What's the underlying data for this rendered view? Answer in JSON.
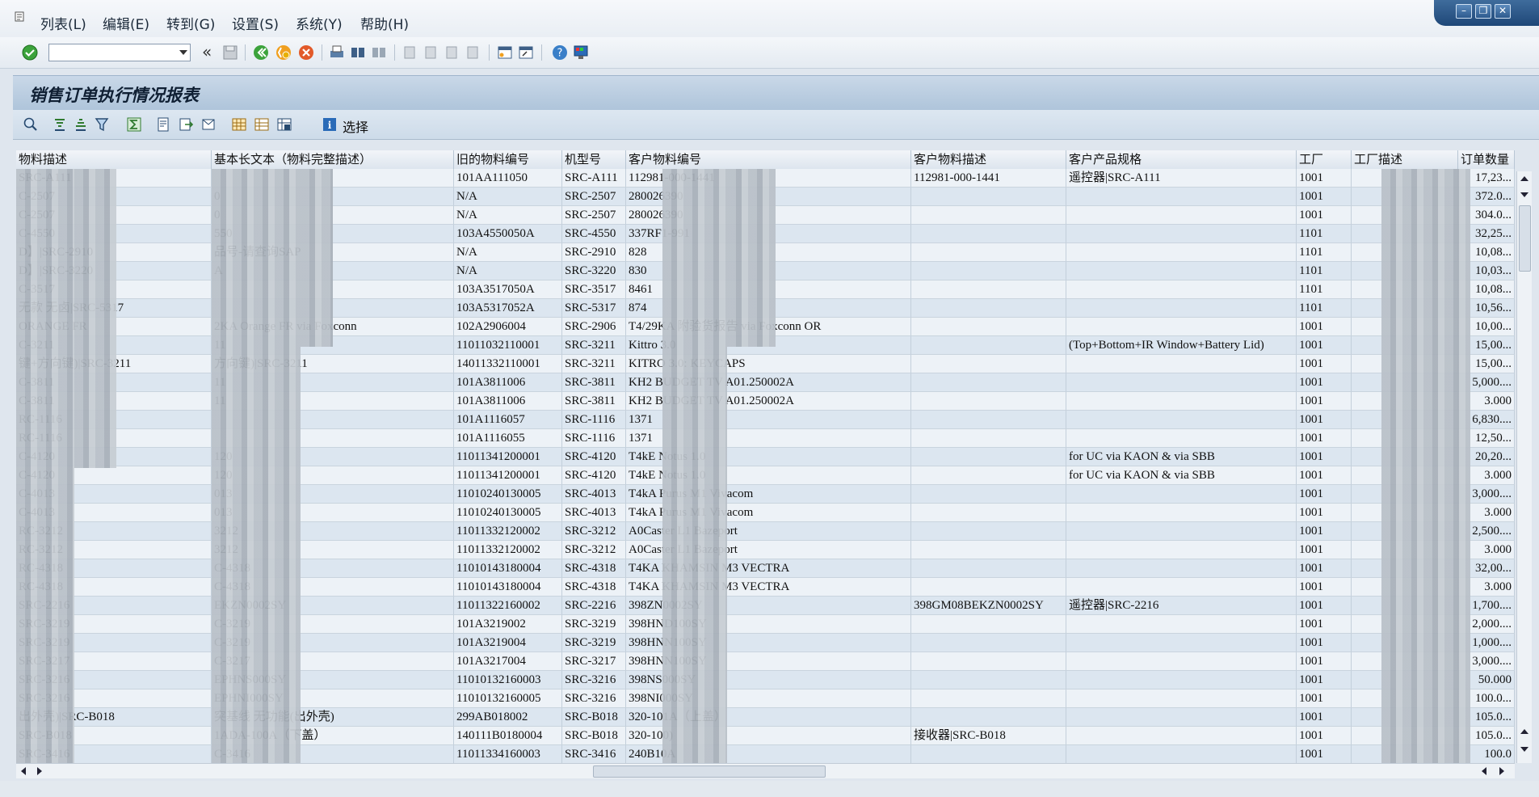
{
  "menu": {
    "items": [
      {
        "label": "列表(L)"
      },
      {
        "label": "编辑(E)"
      },
      {
        "label": "转到(G)"
      },
      {
        "label": "设置(S)"
      },
      {
        "label": "系统(Y)"
      },
      {
        "label": "帮助(H)"
      }
    ]
  },
  "toolbar": {
    "command_value": "",
    "collapse_glyph": "«"
  },
  "report": {
    "title": "销售订单执行情况报表"
  },
  "alv_toolbar": {
    "select_label": "选择"
  },
  "grid": {
    "columns": [
      "物料描述",
      "基本长文本（物料完整描述）",
      "旧的物料编号",
      "机型号",
      "客户物料编号",
      "客户物料描述",
      "客户产品规格",
      "工厂",
      "工厂描述",
      "订单数量"
    ],
    "rows": [
      [
        "SRC-A111",
        "",
        "101AA111050",
        "SRC-A111",
        "112981-000-1441",
        "112981-000-1441",
        "遥控器|SRC-A111",
        "1001",
        "",
        "17,23..."
      ],
      [
        "C-2507",
        "0",
        "N/A",
        "SRC-2507",
        "280026390",
        "",
        "",
        "1001",
        "",
        "372.0..."
      ],
      [
        "C-2507",
        "0",
        "N/A",
        "SRC-2507",
        "280026390",
        "",
        "",
        "1001",
        "",
        "304.0..."
      ],
      [
        "C-4550",
        "550",
        "103A4550050A",
        "SRC-4550",
        "337RF1-991",
        "",
        "",
        "1101",
        "",
        "32,25..."
      ],
      [
        "D】|SRC-2910",
        "品号-请查询SAP",
        "N/A",
        "SRC-2910",
        "828",
        "",
        "",
        "1101",
        "",
        "10,08..."
      ],
      [
        "D】|SRC-3220",
        "A",
        "N/A",
        "SRC-3220",
        "830",
        "",
        "",
        "1101",
        "",
        "10,03..."
      ],
      [
        "C-3517",
        "",
        "103A3517050A",
        "SRC-3517",
        "8461",
        "",
        "",
        "1101",
        "",
        "10,08..."
      ],
      [
        "无款 无卤|SRC-5317",
        "",
        "103A5317052A",
        "SRC-5317",
        "874",
        "",
        "",
        "1101",
        "",
        "10,56..."
      ],
      [
        "ORANGE FR",
        "2KA Orange FR via Foxconn",
        "102A2906004",
        "SRC-2906",
        "T4/29KA 附验货报告 via Foxconn OR",
        "",
        "",
        "1001",
        "",
        "10,00..."
      ],
      [
        "C-3211",
        "11",
        "11011032110001",
        "SRC-3211",
        "Kittro 3.0",
        "",
        "(Top+Bottom+IR Window+Battery Lid)",
        "1001",
        "",
        "15,00..."
      ],
      [
        "键+方向键)|SRC-3211",
        "方向键)|SRC-3211",
        "14011332110001",
        "SRC-3211",
        "KITRO 3.0: KEYCAPS",
        "",
        "",
        "1001",
        "",
        "15,00..."
      ],
      [
        "C-3811",
        "11",
        "101A3811006",
        "SRC-3811",
        "KH2 BUDGET TV A01.250002A",
        "",
        "",
        "1001",
        "",
        "5,000...."
      ],
      [
        "C-3811",
        "11",
        "101A3811006",
        "SRC-3811",
        "KH2 BUDGET TV A01.250002A",
        "",
        "",
        "1001",
        "",
        "3.000"
      ],
      [
        "RC-1116",
        "",
        "101A1116057",
        "SRC-1116",
        "1371",
        "",
        "",
        "1001",
        "",
        "6,830...."
      ],
      [
        "RC-1116",
        "",
        "101A1116055",
        "SRC-1116",
        "1371",
        "",
        "",
        "1001",
        "",
        "12,50..."
      ],
      [
        "C-4120",
        "120",
        "11011341200001",
        "SRC-4120",
        "T4kE Notus 1.0",
        "",
        "for UC via KAON & via SBB",
        "1001",
        "",
        "20,20..."
      ],
      [
        "C-4120",
        "120",
        "11011341200001",
        "SRC-4120",
        "T4kE Notus 1.0",
        "",
        "for UC via KAON & via SBB",
        "1001",
        "",
        "3.000"
      ],
      [
        "C-4013",
        "013",
        "11010240130005",
        "SRC-4013",
        "T4kA Purus M1 Vivacom",
        "",
        "",
        "1001",
        "",
        "3,000...."
      ],
      [
        "C-4013",
        "013",
        "11010240130005",
        "SRC-4013",
        "T4kA Purus M1 Vivacom",
        "",
        "",
        "1001",
        "",
        "3.000"
      ],
      [
        "RC-3212",
        "3212",
        "11011332120002",
        "SRC-3212",
        "A0Caster L1 Bazeport",
        "",
        "",
        "1001",
        "",
        "2,500...."
      ],
      [
        "RC-3212",
        "3212",
        "11011332120002",
        "SRC-3212",
        "A0Caster L1 Bazeport",
        "",
        "",
        "1001",
        "",
        "3.000"
      ],
      [
        "RC-4318",
        "C-4318",
        "11010143180004",
        "SRC-4318",
        "T4KA KHAMSIN M3 VECTRA",
        "",
        "",
        "1001",
        "",
        "32,00..."
      ],
      [
        "RC-4318",
        "C-4318",
        "11010143180004",
        "SRC-4318",
        "T4KA KHAMSIN M3 VECTRA",
        "",
        "",
        "1001",
        "",
        "3.000"
      ],
      [
        "SRC-2216",
        "EKZN0002SY",
        "11011322160002",
        "SRC-2216",
        "398ZN0002SY",
        "398GM08BEKZN0002SY",
        "遥控器|SRC-2216",
        "1001",
        "",
        "1,700...."
      ],
      [
        "SRC-3219",
        "C-3219",
        "101A3219002",
        "SRC-3219",
        "398HND100SY",
        "",
        "",
        "1001",
        "",
        "2,000...."
      ],
      [
        "SRC-3219",
        "C-3219",
        "101A3219004",
        "SRC-3219",
        "398HNN100SY",
        "",
        "",
        "1001",
        "",
        "1,000...."
      ],
      [
        "SRC-3217",
        "C-3217",
        "101A3217004",
        "SRC-3217",
        "398HNN100SY",
        "",
        "",
        "1001",
        "",
        "3,000...."
      ],
      [
        "SRC-3216",
        "EPHNS000SY",
        "11010132160003",
        "SRC-3216",
        "398NS000SY",
        "",
        "",
        "1001",
        "",
        "50.000"
      ],
      [
        "SRC-3216",
        "EPHNI000SY",
        "11010132160005",
        "SRC-3216",
        "398NI000SY",
        "",
        "",
        "1001",
        "",
        "100.0..."
      ],
      [
        "出外壳)|SRC-B018",
        "突基线  无功能(出外壳)",
        "299AB018002",
        "SRC-B018",
        "320-101A（上盖）",
        "",
        "",
        "1001",
        "",
        "105.0..."
      ],
      [
        "SRC-B018",
        "1ADA-100A（下盖）",
        "140111B0180004",
        "SRC-B018",
        "320-100)",
        "接收器|SRC-B018",
        "",
        "1001",
        "",
        "105.0..."
      ],
      [
        "SRC-3416",
        "C-3416",
        "11011334160003",
        "SRC-3416",
        "240B10A",
        "",
        "",
        "1001",
        "",
        "100.0"
      ]
    ]
  },
  "colors": {
    "header_bg": "#e4eaf1",
    "row_odd": "#edf2f7",
    "row_even": "#dce6f0",
    "title_panel": "#b9cde1",
    "window_ctrl": "#2f5a8a"
  }
}
